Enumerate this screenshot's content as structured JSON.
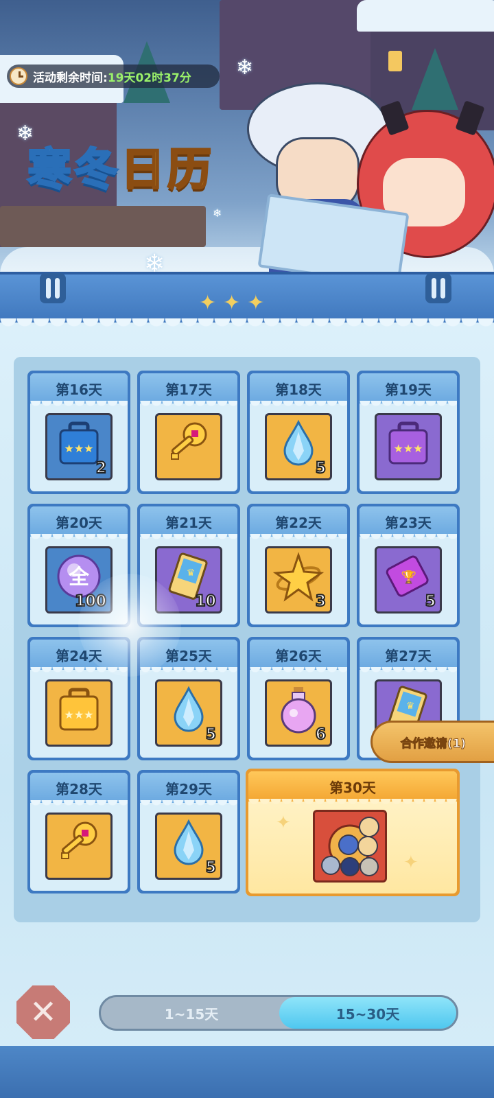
{
  "event": {
    "timer_label": "活动剩余时间:",
    "timer_value": "19天02时37分",
    "title_part1": "寒冬",
    "title_part2": "日历"
  },
  "days": [
    {
      "label": "第16天",
      "item_icon": "blue-gift-box-icon",
      "qty": "2"
    },
    {
      "label": "第17天",
      "item_icon": "golden-key-icon",
      "qty": ""
    },
    {
      "label": "第18天",
      "item_icon": "ice-crystal-drop-icon",
      "qty": "5"
    },
    {
      "label": "第19天",
      "item_icon": "purple-gift-box-icon",
      "qty": ""
    },
    {
      "label": "第20天",
      "item_icon": "universal-orb-icon",
      "qty": "100",
      "orb_text": "全"
    },
    {
      "label": "第21天",
      "item_icon": "blue-ticket-icon",
      "qty": "10"
    },
    {
      "label": "第22天",
      "item_icon": "golden-star-icon",
      "qty": "3"
    },
    {
      "label": "第23天",
      "item_icon": "purple-ticket-icon",
      "qty": "5"
    },
    {
      "label": "第24天",
      "item_icon": "golden-gift-box-icon",
      "qty": ""
    },
    {
      "label": "第25天",
      "item_icon": "ice-crystal-drop-icon",
      "qty": "5"
    },
    {
      "label": "第26天",
      "item_icon": "potion-bottle-icon",
      "qty": "6"
    },
    {
      "label": "第27天",
      "item_icon": "blue-ticket-icon",
      "qty": ""
    },
    {
      "label": "第28天",
      "item_icon": "golden-key-icon",
      "qty": ""
    },
    {
      "label": "第29天",
      "item_icon": "ice-crystal-drop-icon",
      "qty": "5"
    }
  ],
  "grand_prize": {
    "label": "第30天",
    "item_icon": "hero-portrait-bundle-icon"
  },
  "coop_invite": "合作邀请(1)",
  "tabs": {
    "first": "1~15天",
    "second": "15~30天",
    "active": "second"
  },
  "close_icon": "close-x-icon"
}
